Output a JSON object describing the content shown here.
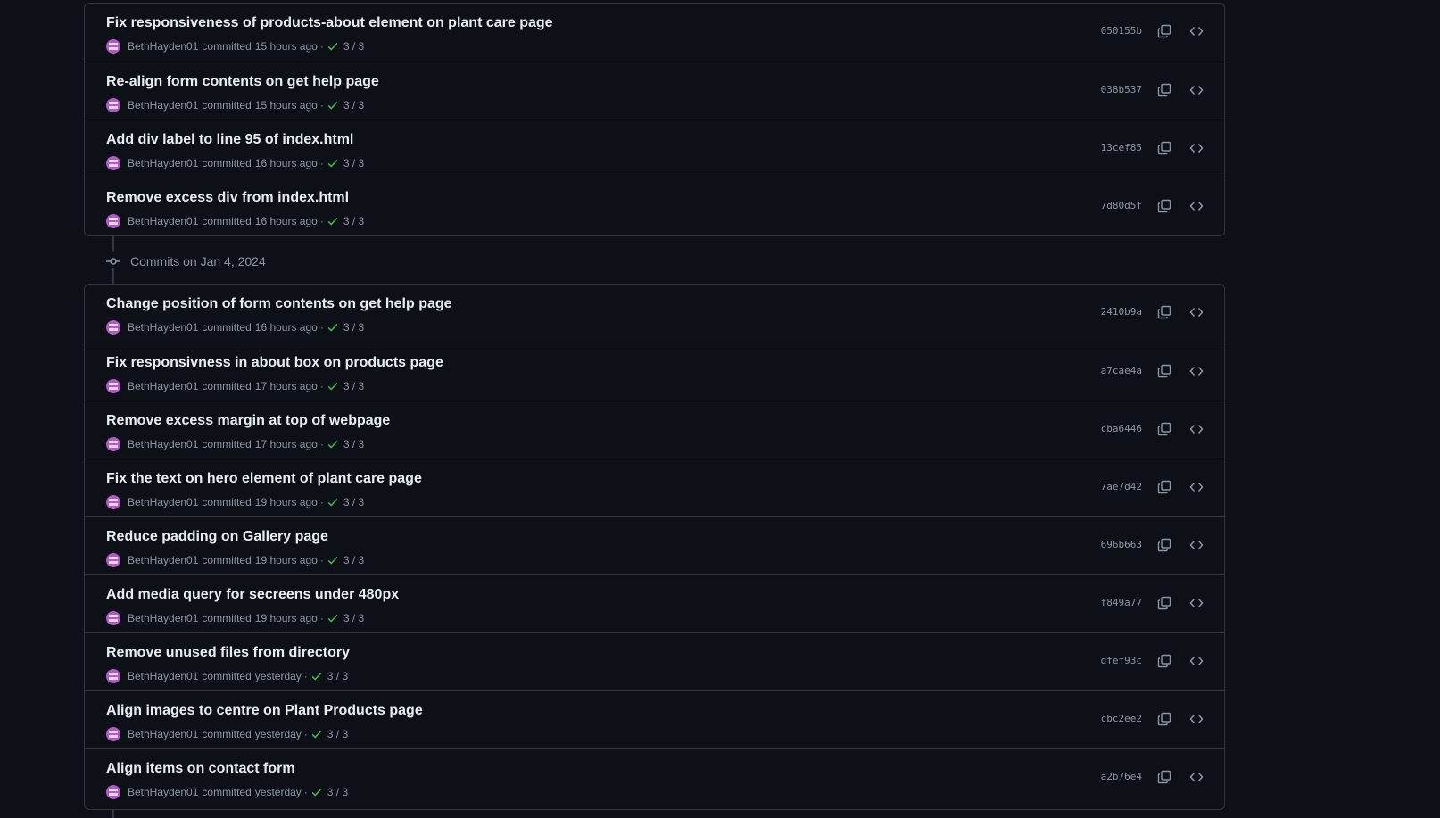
{
  "groups": [
    {
      "header": "",
      "commits": [
        {
          "title": "Fix responsiveness of products-about element on plant care page",
          "author": "BethHayden01",
          "committed": "committed",
          "time": "15 hours ago",
          "checks": "3 / 3",
          "sha": "050155b"
        },
        {
          "title": "Re-align form contents on get help page",
          "author": "BethHayden01",
          "committed": "committed",
          "time": "15 hours ago",
          "checks": "3 / 3",
          "sha": "038b537"
        },
        {
          "title": "Add div label to line 95 of index.html",
          "author": "BethHayden01",
          "committed": "committed",
          "time": "16 hours ago",
          "checks": "3 / 3",
          "sha": "13cef85"
        },
        {
          "title": "Remove excess div from index.html",
          "author": "BethHayden01",
          "committed": "committed",
          "time": "16 hours ago",
          "checks": "3 / 3",
          "sha": "7d80d5f"
        }
      ]
    },
    {
      "header": "Commits on Jan 4, 2024",
      "commits": [
        {
          "title": "Change position of form contents on get help page",
          "author": "BethHayden01",
          "committed": "committed",
          "time": "16 hours ago",
          "checks": "3 / 3",
          "sha": "2410b9a"
        },
        {
          "title": "Fix responsivness in about box on products page",
          "author": "BethHayden01",
          "committed": "committed",
          "time": "17 hours ago",
          "checks": "3 / 3",
          "sha": "a7cae4a"
        },
        {
          "title": "Remove excess margin at top of webpage",
          "author": "BethHayden01",
          "committed": "committed",
          "time": "17 hours ago",
          "checks": "3 / 3",
          "sha": "cba6446"
        },
        {
          "title": "Fix the text on hero element of plant care page",
          "author": "BethHayden01",
          "committed": "committed",
          "time": "19 hours ago",
          "checks": "3 / 3",
          "sha": "7ae7d42"
        },
        {
          "title": "Reduce padding on Gallery page",
          "author": "BethHayden01",
          "committed": "committed",
          "time": "19 hours ago",
          "checks": "3 / 3",
          "sha": "696b663"
        },
        {
          "title": "Add media query for secreens under 480px",
          "author": "BethHayden01",
          "committed": "committed",
          "time": "19 hours ago",
          "checks": "3 / 3",
          "sha": "f849a77"
        },
        {
          "title": "Remove unused files from directory",
          "author": "BethHayden01",
          "committed": "committed",
          "time": "yesterday",
          "checks": "3 / 3",
          "sha": "dfef93c"
        },
        {
          "title": "Align images to centre on Plant Products page",
          "author": "BethHayden01",
          "committed": "committed",
          "time": "yesterday",
          "checks": "3 / 3",
          "sha": "cbc2ee2"
        },
        {
          "title": "Align items on contact form",
          "author": "BethHayden01",
          "committed": "committed",
          "time": "yesterday",
          "checks": "3 / 3",
          "sha": "a2b76e4"
        }
      ]
    }
  ],
  "icons": {
    "copy": "copy-icon",
    "browse": "code-icon",
    "check": "check-icon",
    "commit": "git-commit-icon"
  },
  "colors": {
    "background": "#0d1117",
    "border": "#30363d",
    "muted": "#8d96a0",
    "success": "#3fb950",
    "avatar": "#b15ac6"
  }
}
